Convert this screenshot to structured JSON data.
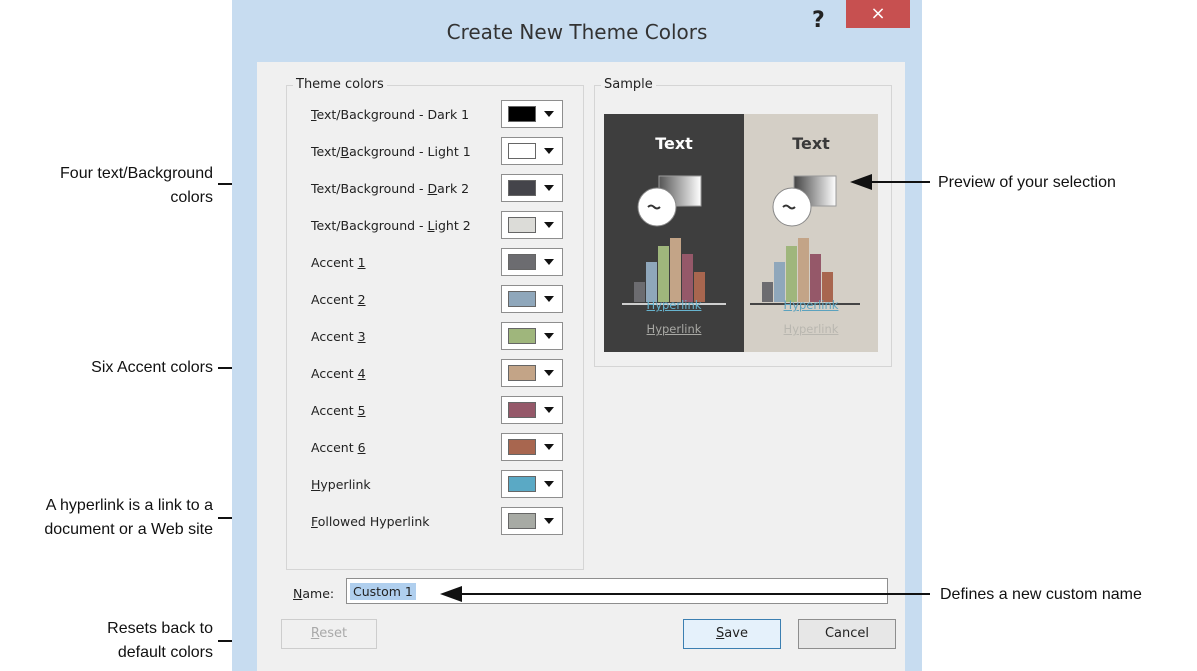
{
  "dialog": {
    "title": "Create New Theme Colors",
    "help_glyph": "?",
    "close_glyph": "×",
    "theme_colors_group": {
      "label": "Theme colors",
      "rows": [
        {
          "pre": "",
          "key": "T",
          "post": "ext/Background - Dark 1",
          "color": "#000000"
        },
        {
          "pre": "Text/",
          "key": "B",
          "post": "ackground - Light 1",
          "color": "#ffffff"
        },
        {
          "pre": "Text/Background - ",
          "key": "D",
          "post": "ark 2",
          "color": "#44444a"
        },
        {
          "pre": "Text/Background - ",
          "key": "L",
          "post": "ight 2",
          "color": "#dcdcd8"
        },
        {
          "pre": "Accent ",
          "key": "1",
          "post": "",
          "color": "#6c6c70"
        },
        {
          "pre": "Accent ",
          "key": "2",
          "post": "",
          "color": "#8fa7bb"
        },
        {
          "pre": "Accent ",
          "key": "3",
          "post": "",
          "color": "#9fb67c"
        },
        {
          "pre": "Accent ",
          "key": "4",
          "post": "",
          "color": "#c3a487"
        },
        {
          "pre": "Accent ",
          "key": "5",
          "post": "",
          "color": "#955869"
        },
        {
          "pre": "Accent ",
          "key": "6",
          "post": "",
          "color": "#a8664f"
        },
        {
          "pre": "",
          "key": "H",
          "post": "yperlink",
          "color": "#5aa9c5"
        },
        {
          "pre": "",
          "key": "F",
          "post": "ollowed Hyperlink",
          "color": "#a7aaa4"
        }
      ]
    },
    "sample_group": {
      "label": "Sample",
      "dark_text": "Text",
      "light_text": "Text",
      "hyperlink": "Hyperlink",
      "followed_hyperlink": "Hyperlink"
    },
    "name": {
      "pre": "",
      "key": "N",
      "post": "ame:",
      "value": "Custom 1"
    },
    "buttons": {
      "reset": {
        "key": "R",
        "post": "eset"
      },
      "save": {
        "key": "S",
        "post": "ave"
      },
      "cancel": "Cancel"
    }
  },
  "callouts": {
    "four_text_background_1": "Four text/Background",
    "four_text_background_2": "colors",
    "six_accent": "Six Accent colors",
    "hyperlink_1": "A hyperlink is a link to a",
    "hyperlink_2": "document or a Web site",
    "resets_1": "Resets back to",
    "resets_2": "default colors",
    "preview": "Preview of your selection",
    "defines_name": "Defines a new custom name"
  },
  "colors": {
    "dialog_border": "#c7dcf0",
    "close_button": "#c75050",
    "sample_dark_bg": "#3e3e3e",
    "sample_light_bg": "#d4cfc6",
    "hyperlink_dark": "#67b4cf",
    "followed_dark": "#a8a8a4",
    "hyperlink_light": "#5ba2be",
    "followed_light": "#b9b7b0"
  }
}
